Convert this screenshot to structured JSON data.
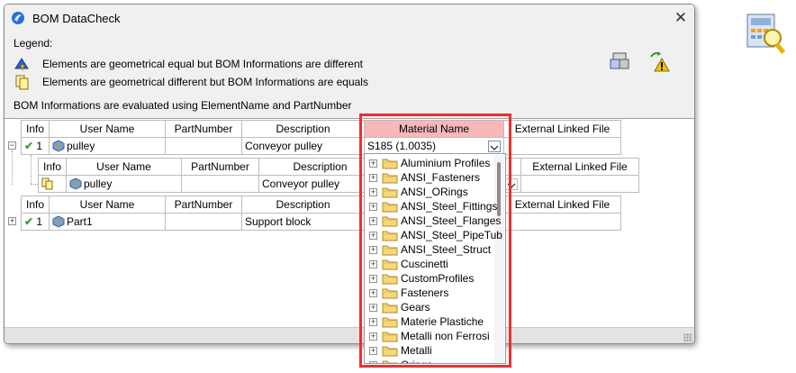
{
  "window": {
    "title": "BOM DataCheck",
    "close_glyph": "✕"
  },
  "legend": {
    "title": "Legend:",
    "items": [
      {
        "icon": "geometric-equal-warning-icon",
        "text": "Elements are geometrical equal but BOM Informations are different"
      },
      {
        "icon": "geometric-different-icon",
        "text": "Elements are geometrical different but BOM Informations are equals"
      }
    ]
  },
  "note": "BOM Informations are evaluated using ElementName and PartNumber",
  "grid": {
    "headers": {
      "info": "Info",
      "user_name": "User Name",
      "part_number": "PartNumber",
      "description": "Description",
      "material_name": "Material Name",
      "external_linked_file": "External Linked File"
    },
    "rows": [
      {
        "expander": "⊟",
        "info_count": "1",
        "user_name": "pulley",
        "part_number": "",
        "description": "Conveyor pulley",
        "material": "S185  (1.0035)",
        "external": ""
      },
      {
        "expander": "",
        "info_count": "",
        "user_name": "pulley",
        "part_number": "",
        "description": "Conveyor pulley",
        "material": "",
        "external": ""
      },
      {
        "expander": "⊞",
        "info_count": "1",
        "user_name": "Part1",
        "part_number": "",
        "description": "Support block",
        "material": "",
        "external": ""
      }
    ]
  },
  "material_dropdown": {
    "items": [
      "Aluminium Profiles",
      "ANSI_Fasteners",
      "ANSI_ORings",
      "ANSI_Steel_Fittings",
      "ANSI_Steel_Flanges",
      "ANSI_Steel_PipeTub",
      "ANSI_Steel_Struct",
      "Cuscinetti",
      "CustomProfiles",
      "Fasteners",
      "Gears",
      "Materie Plastiche",
      "Metalli non Ferrosi",
      "Metalli",
      "Orings"
    ]
  },
  "colors": {
    "highlight": "#e63232",
    "material_header": "#f8b8b8",
    "check": "#3aa33a"
  }
}
